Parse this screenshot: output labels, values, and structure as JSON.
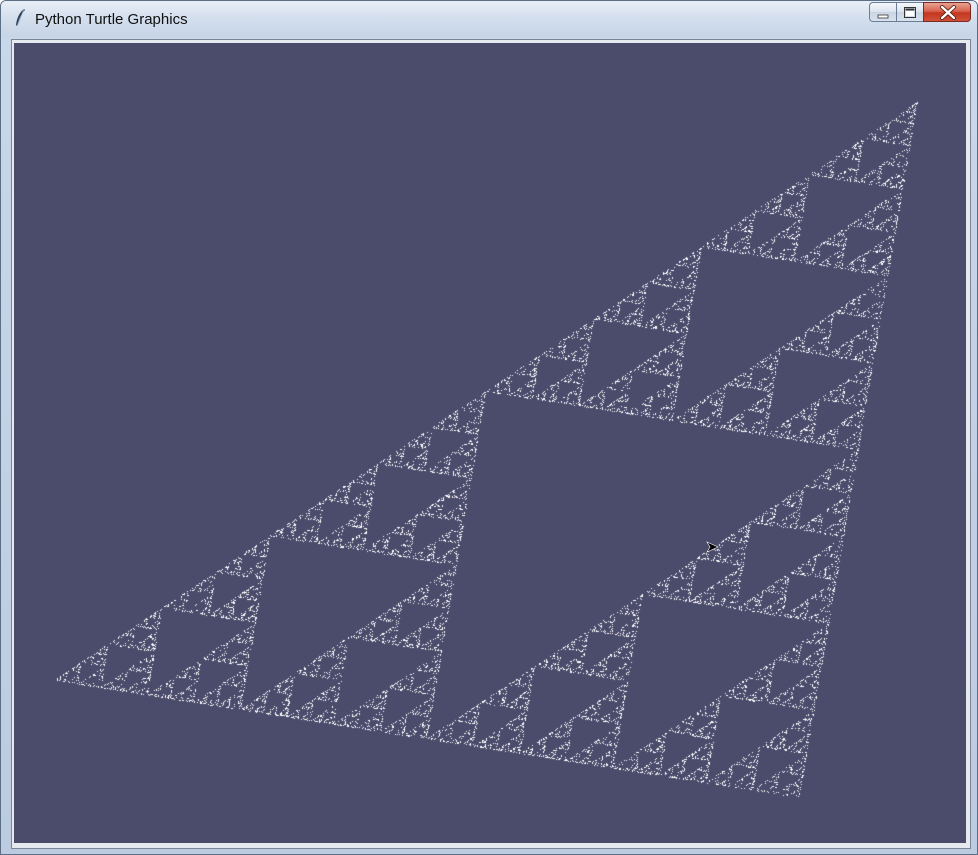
{
  "window": {
    "title": "Python Turtle Graphics",
    "app_icon": "python-feather-icon"
  },
  "controls": {
    "minimize_icon": "minimize-icon",
    "maximize_icon": "maximize-icon",
    "close_icon": "close-icon"
  },
  "canvas": {
    "background_color": "#4b4b6c",
    "pen_color": "#ffffff",
    "drawing": "sierpinski-triangle",
    "cursor_icon": "turtle-arrow-icon"
  }
}
